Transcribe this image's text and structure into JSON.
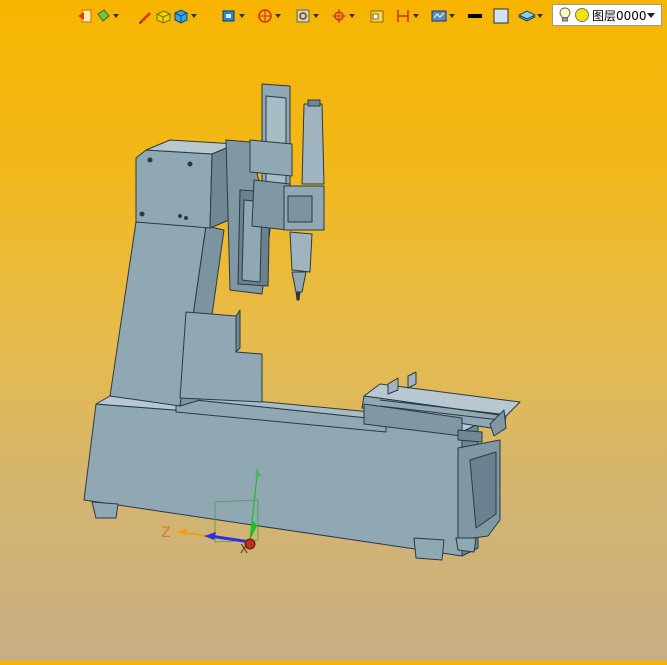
{
  "toolbar": {
    "icons": [
      "exit-icon",
      "paint-bucket-icon",
      "pencil-icon",
      "solid-box-icon",
      "shaded-cube-icon",
      "render-cube-icon",
      "view-orient-icon",
      "zoom-fit-icon",
      "pan-icon",
      "window-icon",
      "section-icon",
      "display-mode-icon",
      "line-color-icon",
      "fill-color-icon",
      "layer-display-icon"
    ],
    "layer_name": "图层0000",
    "line_color": "#000000",
    "fill_color": "#cfe3f5"
  },
  "viewport": {
    "background_top": "#f7b500",
    "background_bottom": "#c7ad82",
    "model_color": "#8fa8b4",
    "edge_color": "#2a3a44"
  },
  "triad": {
    "z_label": "Z",
    "x_label": "X",
    "z_color": "#f0a000",
    "x_color": "#3030e0",
    "y_color": "#20c020",
    "origin_color": "#c03020"
  }
}
